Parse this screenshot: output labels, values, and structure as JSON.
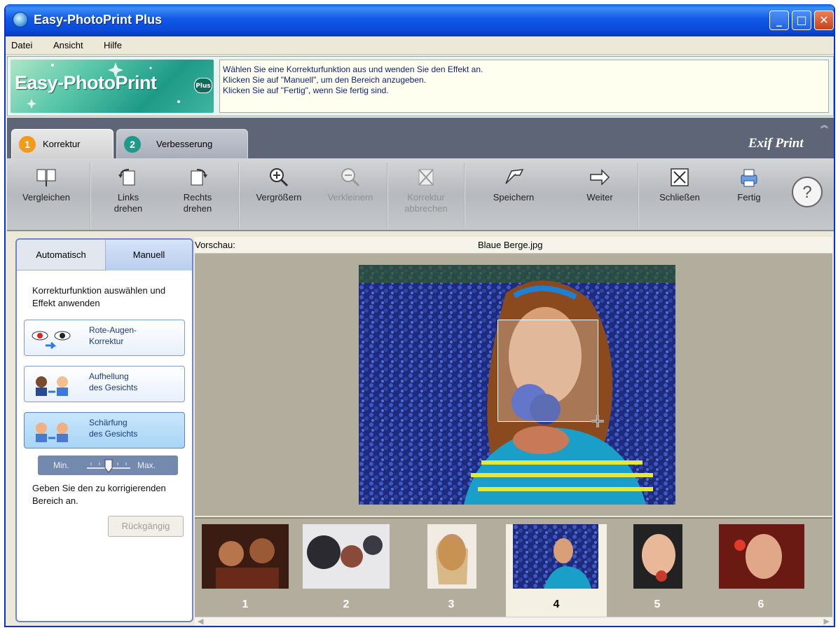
{
  "window": {
    "title": "Easy-PhotoPrint Plus",
    "title_buttons": [
      "minimize",
      "maximize",
      "close"
    ]
  },
  "menu": [
    "Datei",
    "Ansicht",
    "Hilfe"
  ],
  "banner": {
    "logo_text": "Easy-PhotoPrint",
    "logo_badge": "Plus",
    "instructions": [
      "Wählen Sie eine Korrekturfunktion aus und wenden Sie den Effekt an.",
      "Klicken Sie auf \"Manuell\", um den Bereich anzugeben.",
      "Klicken Sie auf \"Fertig\", wenn Sie fertig sind."
    ]
  },
  "tabs": [
    {
      "num": "1",
      "label": "Korrektur",
      "active": true,
      "color": "#f29a1a"
    },
    {
      "num": "2",
      "label": "Verbesserung",
      "active": false,
      "color": "#1f9a8a"
    }
  ],
  "exif_label": "Exif Print",
  "toolbar": [
    {
      "icon": "compare-icon",
      "label": "Vergleichen",
      "enabled": true
    },
    {
      "icon": "rotate-left-icon",
      "label": "Links\ndrehen",
      "enabled": true
    },
    {
      "icon": "rotate-right-icon",
      "label": "Rechts\ndrehen",
      "enabled": true
    },
    {
      "icon": "zoom-in-icon",
      "label": "Vergrößern",
      "enabled": true
    },
    {
      "icon": "zoom-out-icon",
      "label": "Verkleinern",
      "enabled": false
    },
    {
      "icon": "cancel-correction-icon",
      "label": "Korrektur\nabbrechen",
      "enabled": false
    },
    {
      "icon": "save-icon",
      "label": "Speichern",
      "enabled": true
    },
    {
      "icon": "next-arrow-icon",
      "label": "Weiter",
      "enabled": true
    },
    {
      "icon": "close-icon",
      "label": "Schließen",
      "enabled": true
    },
    {
      "icon": "done-printer-icon",
      "label": "Fertig",
      "enabled": true
    },
    {
      "icon": "help-icon",
      "label": "?",
      "enabled": true
    }
  ],
  "left_panel": {
    "tabs": [
      {
        "label": "Automatisch",
        "active": false
      },
      {
        "label": "Manuell",
        "active": true
      }
    ],
    "intro": "Korrekturfunktion auswählen und Effekt anwenden",
    "functions": [
      {
        "icon": "red-eye-icon",
        "label": "Rote-Augen-\nKorrektur",
        "selected": false
      },
      {
        "icon": "face-brighten-icon",
        "label": "Aufhellung\ndes Gesichts",
        "selected": false
      },
      {
        "icon": "face-sharpen-icon",
        "label": "Schärfung\ndes Gesichts",
        "selected": true
      }
    ],
    "slider": {
      "min_label": "Min.",
      "max_label": "Max.",
      "value": 0.5
    },
    "hint": "Geben Sie den zu korrigierenden Bereich an.",
    "undo_label": "Rückgängig"
  },
  "preview": {
    "label": "Vorschau:",
    "filename": "Blaue Berge.jpg"
  },
  "thumbnails": [
    {
      "num": "1",
      "selected": false
    },
    {
      "num": "2",
      "selected": false
    },
    {
      "num": "3",
      "selected": false
    },
    {
      "num": "4",
      "selected": true
    },
    {
      "num": "5",
      "selected": false
    },
    {
      "num": "6",
      "selected": false
    }
  ],
  "colors": {
    "titlebar": "#0a5ff0",
    "accent_tab": "#f29a1a"
  }
}
